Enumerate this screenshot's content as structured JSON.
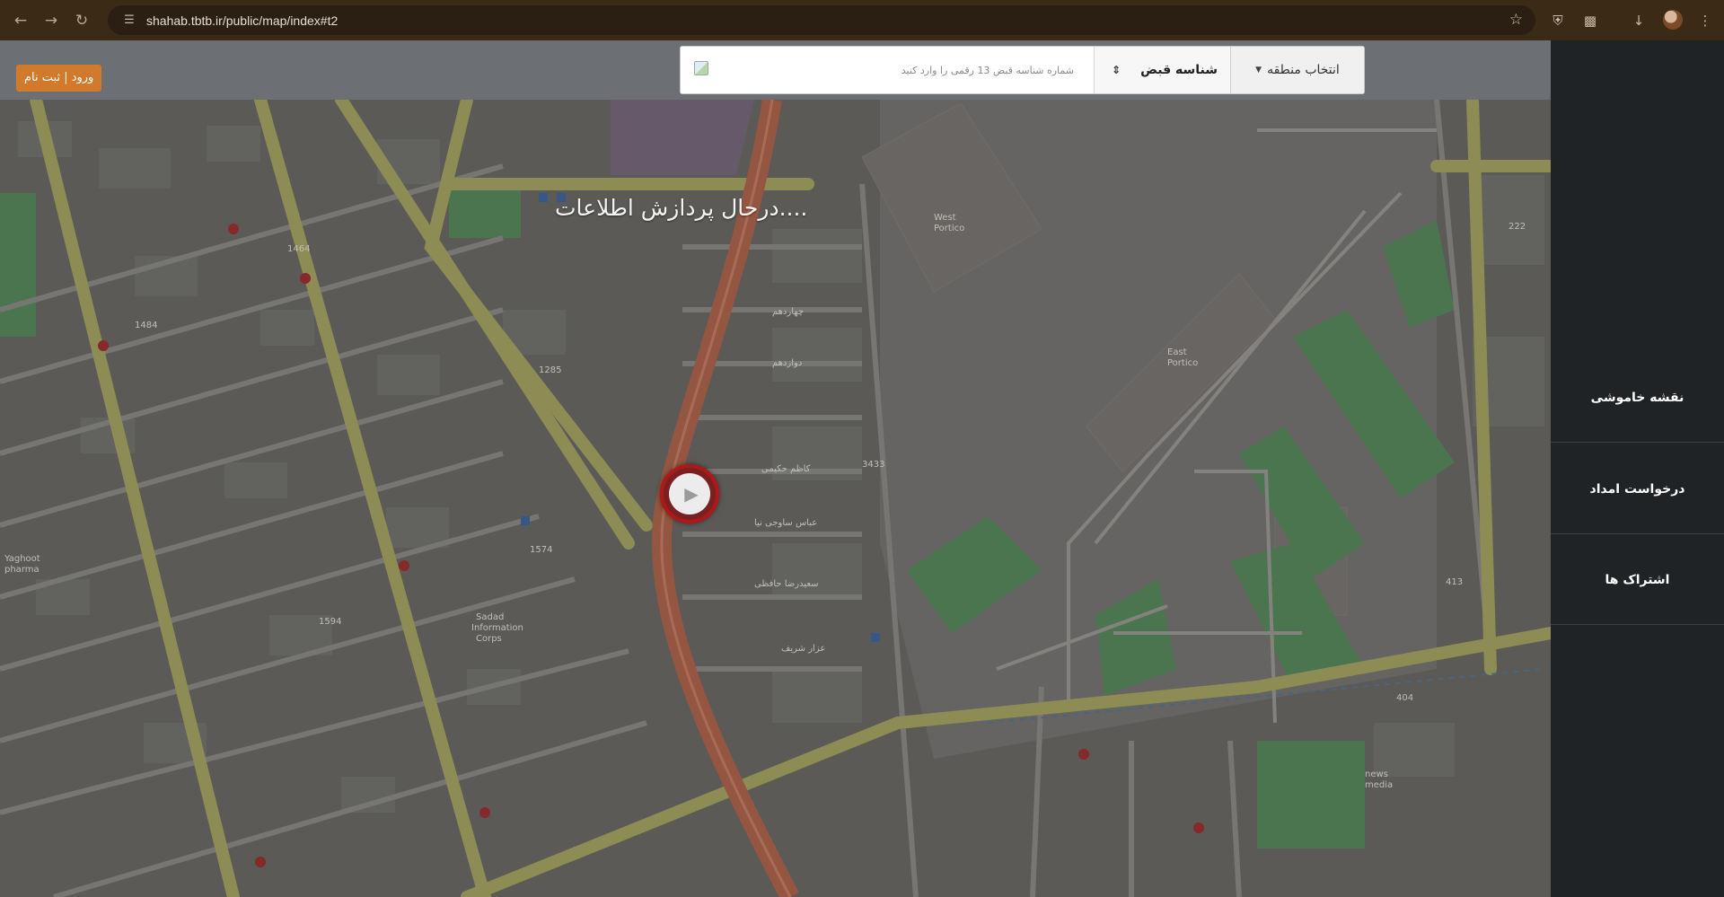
{
  "browser": {
    "url": "shahab.tbtb.ir/public/map/index#t2",
    "icons": [
      "back-icon",
      "forward-icon",
      "reload-icon",
      "site-info-icon",
      "star-icon",
      "shield-icon",
      "extensions-icon",
      "download-icon",
      "profile-avatar",
      "menu-icon"
    ]
  },
  "header": {
    "login_label": "ورود | ثبت نام",
    "region_button": "انتخاب منطقه",
    "id_type_select": "شناسه قبض",
    "bill_input_placeholder": "شماره شناسه قبض 13 رقمی را وارد کنید"
  },
  "map": {
    "status_text": "درحال پردازش اطلاعات....",
    "colors": {
      "accent_orange": "#d27a2c",
      "marker_red": "#b01818",
      "sidebar_bg": "#1f2326"
    }
  },
  "sidebar": {
    "items": [
      {
        "label": "نقشه خاموشی"
      },
      {
        "label": "درخواست امداد"
      },
      {
        "label": "اشتراک ها"
      }
    ]
  }
}
